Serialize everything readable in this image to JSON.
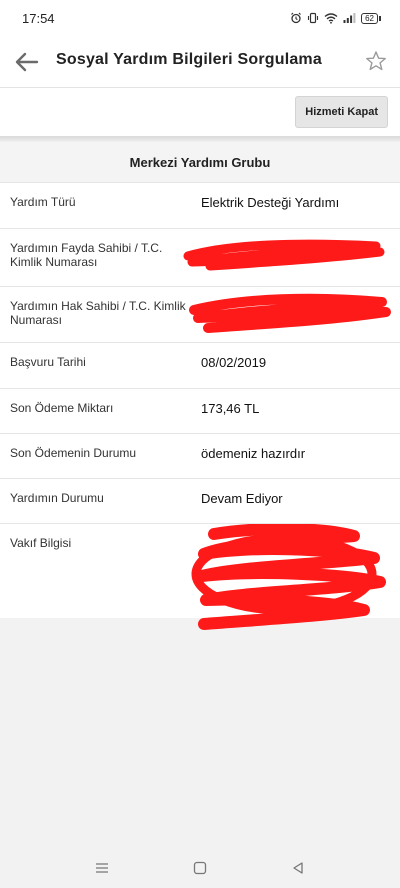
{
  "status_bar": {
    "time": "17:54",
    "battery": "62"
  },
  "app_bar": {
    "title": "Sosyal Yardım Bilgileri Sorgulama"
  },
  "toolbar": {
    "close_service_label": "Hizmeti Kapat"
  },
  "group": {
    "title": "Merkezi Yardımı Grubu"
  },
  "rows": [
    {
      "label": "Yardım Türü",
      "value": "Elektrik Desteği Yardımı"
    },
    {
      "label": "Yardımın Fayda Sahibi / T.C. Kimlik Numarası",
      "value": ""
    },
    {
      "label": "Yardımın Hak Sahibi / T.C. Kimlik Numarası",
      "value": ""
    },
    {
      "label": "Başvuru Tarihi",
      "value": "08/02/2019"
    },
    {
      "label": "Son Ödeme Miktarı",
      "value": "173,46 TL"
    },
    {
      "label": "Son Ödemenin Durumu",
      "value": "ödemeniz hazırdır"
    },
    {
      "label": "Yardımın Durumu",
      "value": "Devam Ediyor"
    },
    {
      "label": "Vakıf Bilgisi",
      "value": ""
    }
  ],
  "colors": {
    "redaction": "#ff1a1a"
  }
}
